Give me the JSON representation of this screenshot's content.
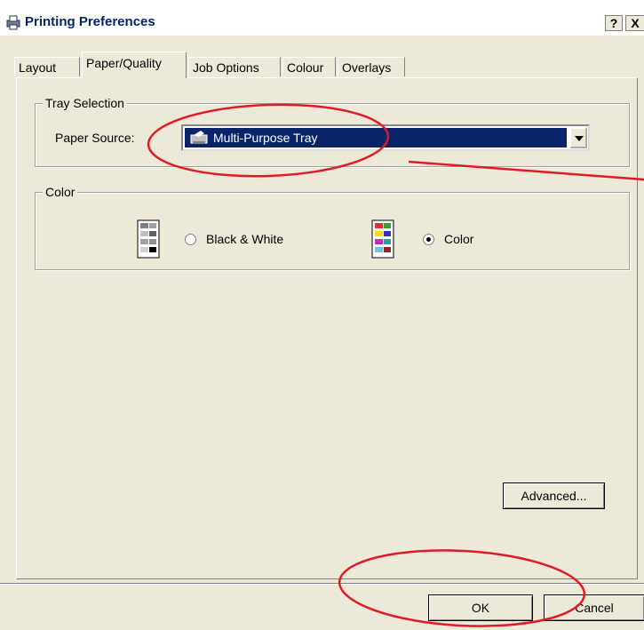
{
  "window": {
    "title": "Printing Preferences",
    "help_label": "?",
    "close_label": "X"
  },
  "tabs": [
    {
      "label": "Layout"
    },
    {
      "label": "Paper/Quality"
    },
    {
      "label": "Job Options"
    },
    {
      "label": "Colour"
    },
    {
      "label": "Overlays"
    }
  ],
  "tray_selection": {
    "legend": "Tray Selection",
    "paper_source_label": "Paper Source:",
    "paper_source_value": "Multi-Purpose Tray"
  },
  "color": {
    "legend": "Color",
    "bw_label": "Black & White",
    "color_label": "Color",
    "selected": "Color"
  },
  "buttons": {
    "advanced": "Advanced...",
    "ok": "OK",
    "cancel": "Cancel"
  },
  "colors": {
    "selection": "#0a246a",
    "annotation": "#e01b24",
    "dialog_bg": "#ece9d8"
  }
}
